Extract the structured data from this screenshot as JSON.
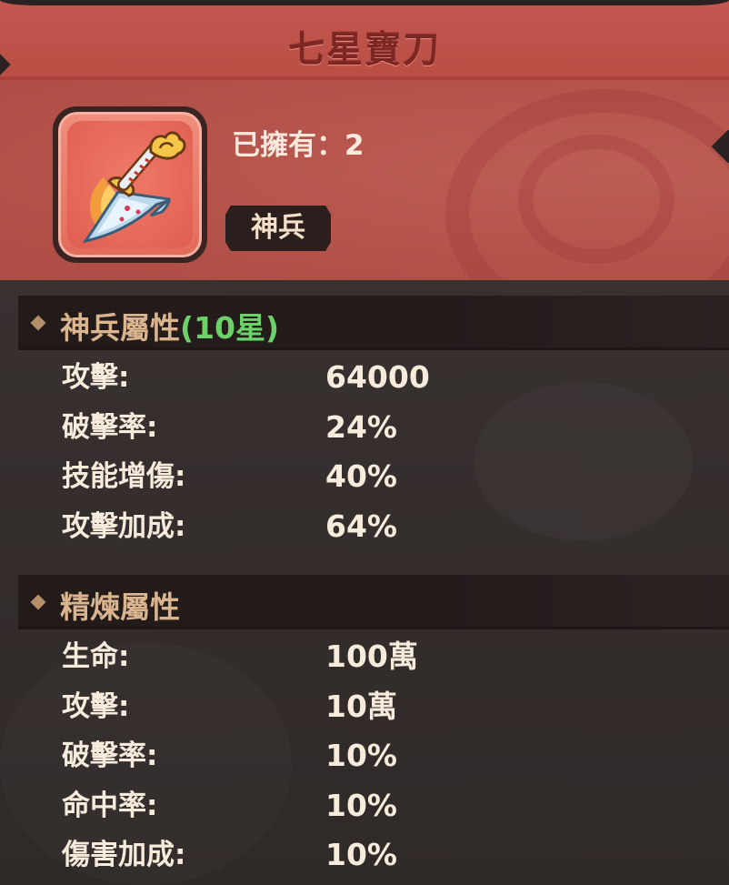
{
  "item": {
    "name": "七星寶刀",
    "owned_text": "已擁有：2",
    "type": "神兵",
    "icon": "seven-star-saber-icon"
  },
  "divine_attributes": {
    "title": "神兵屬性",
    "stars_text": "(10星)",
    "rows": [
      {
        "label": "攻擊:",
        "value": "64000"
      },
      {
        "label": "破擊率:",
        "value": "24%"
      },
      {
        "label": "技能增傷:",
        "value": "40%"
      },
      {
        "label": "攻擊加成:",
        "value": "64%"
      }
    ]
  },
  "refine_attributes": {
    "title": "精煉屬性",
    "rows": [
      {
        "label": "生命:",
        "value": "100萬"
      },
      {
        "label": "攻擊:",
        "value": "10萬"
      },
      {
        "label": "破擊率:",
        "value": "10%"
      },
      {
        "label": "命中率:",
        "value": "10%"
      },
      {
        "label": "傷害加成:",
        "value": "10%"
      }
    ]
  },
  "colors": {
    "title_bar": "#c2584f",
    "header_body": "#b5554c",
    "panel_bg": "#342e2d",
    "section_header_bg": "#221b1a",
    "section_title": "#d9b48e",
    "stars_green": "#6bd26a",
    "text_light": "#f7ebdc"
  }
}
